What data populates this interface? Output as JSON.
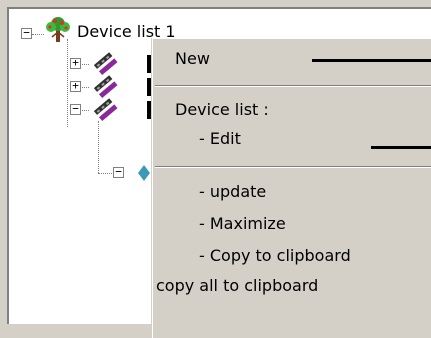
{
  "tree": {
    "root": {
      "label": "Device list 1",
      "expander": "−",
      "icon": "tree-root-icon"
    },
    "children": [
      {
        "expander": "+",
        "icon": "device-icon"
      },
      {
        "expander": "+",
        "icon": "device-icon"
      },
      {
        "expander": "−",
        "icon": "device-icon"
      }
    ],
    "grandchild": {
      "expander": "−",
      "icon": "leaf-icon"
    }
  },
  "context_menu": {
    "new": "New",
    "device_list_header": "Device list :",
    "edit": "- Edit",
    "update": "- update",
    "maximize": "- Maximize",
    "copy_to_clipboard": "- Copy to clipboard",
    "copy_all": "copy all to clipboard"
  },
  "colors": {
    "window_bg": "#d4d0c8",
    "panel_bg": "#ffffff",
    "callout": "#000000"
  }
}
